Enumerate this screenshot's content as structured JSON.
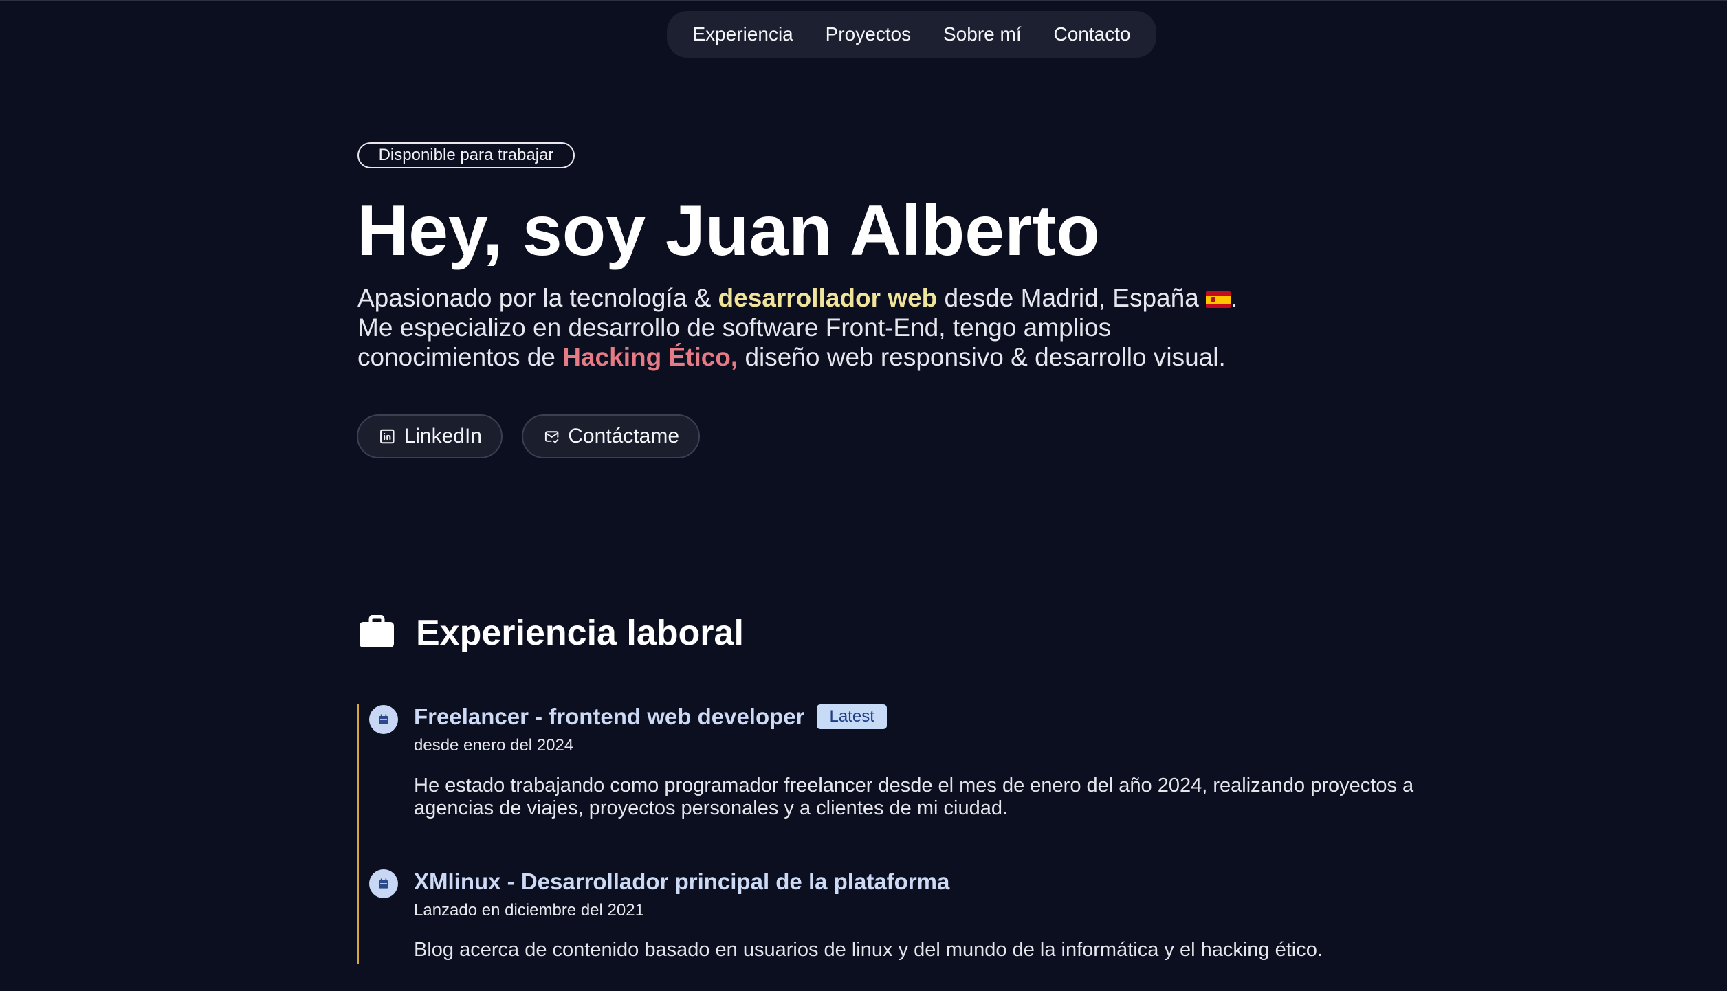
{
  "nav": {
    "items": [
      "Experiencia",
      "Proyectos",
      "Sobre mí",
      "Contacto"
    ]
  },
  "hero": {
    "badge": "Disponible para trabajar",
    "title": "Hey, soy Juan Alberto",
    "desc_part1": "Apasionado por la tecnología & ",
    "desc_highlight1": "desarrollador web",
    "desc_part2": " desde Madrid, España ",
    "desc_part3": ". Me especializo en desarrollo de software Front-End, tengo amplios conocimientos de ",
    "desc_highlight2": "Hacking Ético,",
    "desc_part4": " diseño web responsivo & desarrollo visual.",
    "flag_icon": "spain-flag-icon",
    "buttons": {
      "linkedin": "LinkedIn",
      "contact": "Contáctame"
    }
  },
  "experience": {
    "title": "Experiencia laboral",
    "icon": "briefcase-icon",
    "jobs": [
      {
        "title": "Freelancer - frontend web developer",
        "badge": "Latest",
        "date": "desde enero del 2024",
        "description": "He estado trabajando como programador freelancer desde el mes de enero del año 2024, realizando proyectos a agencias de viajes, proyectos personales y a clientes de mi ciudad."
      },
      {
        "title": "XMlinux - Desarrollador principal de la plataforma",
        "date": "Lanzado en diciembre del 2021",
        "description": "Blog acerca de contenido basado en usuarios de linux y del mundo de la informática y el hacking ético."
      }
    ]
  },
  "colors": {
    "background": "#0c0f20",
    "highlight_yellow": "#f0e39a",
    "highlight_red": "#e67b85",
    "timeline": "#d7a83b",
    "job_title": "#cddaf6",
    "badge_bg": "#c7dbf7"
  }
}
